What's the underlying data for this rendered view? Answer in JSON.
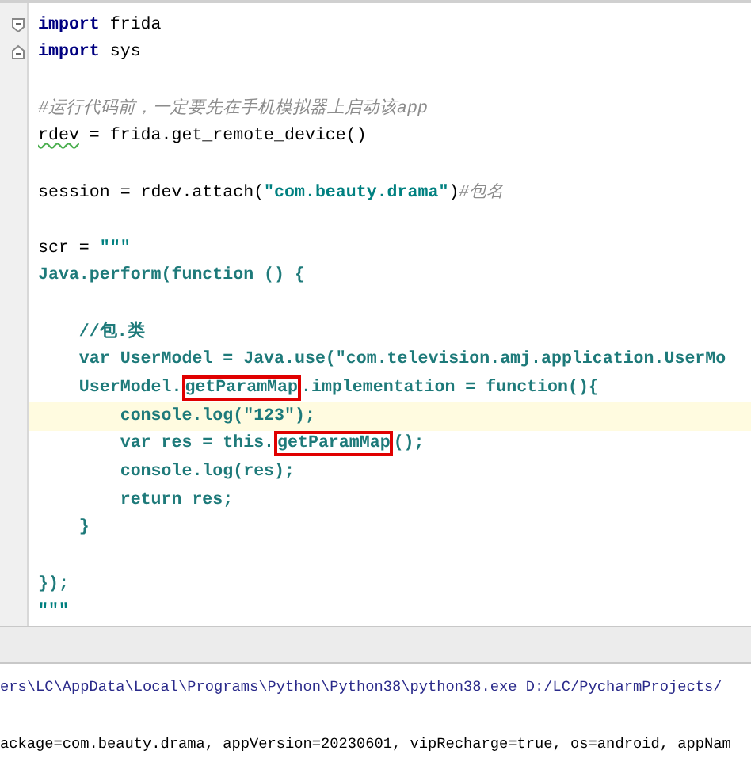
{
  "editor": {
    "lines": [
      {
        "fold_open": true,
        "tokens": [
          {
            "text": "import",
            "kind": "keyword"
          },
          {
            "text": " frida",
            "kind": "plain"
          }
        ]
      },
      {
        "fold_close": true,
        "tokens": [
          {
            "text": "import",
            "kind": "keyword"
          },
          {
            "text": " sys",
            "kind": "plain"
          }
        ]
      },
      {
        "blank": true
      },
      {
        "tokens": [
          {
            "text": "#运行代码前，一定要先在手机模拟器上启动该app",
            "kind": "comment"
          }
        ]
      },
      {
        "tokens": [
          {
            "text": "rdev",
            "kind": "plain",
            "warning": true
          },
          {
            "text": " = frida.get_remote_device()",
            "kind": "plain"
          }
        ]
      },
      {
        "blank": true
      },
      {
        "tokens": [
          {
            "text": "session = rdev.attach(",
            "kind": "plain"
          },
          {
            "text": "\"com.beauty.drama\"",
            "kind": "string"
          },
          {
            "text": ")",
            "kind": "plain"
          },
          {
            "text": "#包名",
            "kind": "comment"
          }
        ]
      },
      {
        "blank": true
      },
      {
        "tokens": [
          {
            "text": "scr = ",
            "kind": "plain"
          },
          {
            "text": "\"\"\"",
            "kind": "string"
          }
        ]
      },
      {
        "tokens": [
          {
            "text": "Java.perform(function () {",
            "kind": "embedded"
          }
        ]
      },
      {
        "blank": true
      },
      {
        "tokens": [
          {
            "text": "    //包.类",
            "kind": "embedded"
          }
        ]
      },
      {
        "tokens": [
          {
            "text": "    var UserModel = Java.use(\"com.television.amj.application.UserMo",
            "kind": "embedded"
          }
        ]
      },
      {
        "tokens": [
          {
            "text": "    UserModel.",
            "kind": "embedded"
          },
          {
            "text": "getParamMap",
            "kind": "embedded",
            "boxed": true
          },
          {
            "text": ".implementation = function(){",
            "kind": "embedded"
          }
        ]
      },
      {
        "current": true,
        "tokens": [
          {
            "text": "        console.log(\"123\");",
            "kind": "embedded"
          }
        ]
      },
      {
        "tokens": [
          {
            "text": "        var res = this.",
            "kind": "embedded"
          },
          {
            "text": "getParamMap",
            "kind": "embedded",
            "boxed": true
          },
          {
            "text": "();",
            "kind": "embedded"
          }
        ]
      },
      {
        "tokens": [
          {
            "text": "        console.log(res);",
            "kind": "embedded"
          }
        ]
      },
      {
        "tokens": [
          {
            "text": "        return res;",
            "kind": "embedded"
          }
        ]
      },
      {
        "tokens": [
          {
            "text": "    }",
            "kind": "embedded"
          }
        ]
      },
      {
        "blank": true
      },
      {
        "tokens": [
          {
            "text": "});",
            "kind": "embedded"
          }
        ]
      },
      {
        "tokens": [
          {
            "text": "\"\"\"",
            "kind": "string"
          }
        ]
      }
    ]
  },
  "console": {
    "lines": [
      {
        "text": "ers\\LC\\AppData\\Local\\Programs\\Python\\Python38\\python38.exe D:/LC/PycharmProjects/",
        "kind": "command"
      },
      {
        "text": "ackage=com.beauty.drama, appVersion=20230601, vipRecharge=true, os=android, appNam",
        "kind": "output"
      }
    ]
  }
}
